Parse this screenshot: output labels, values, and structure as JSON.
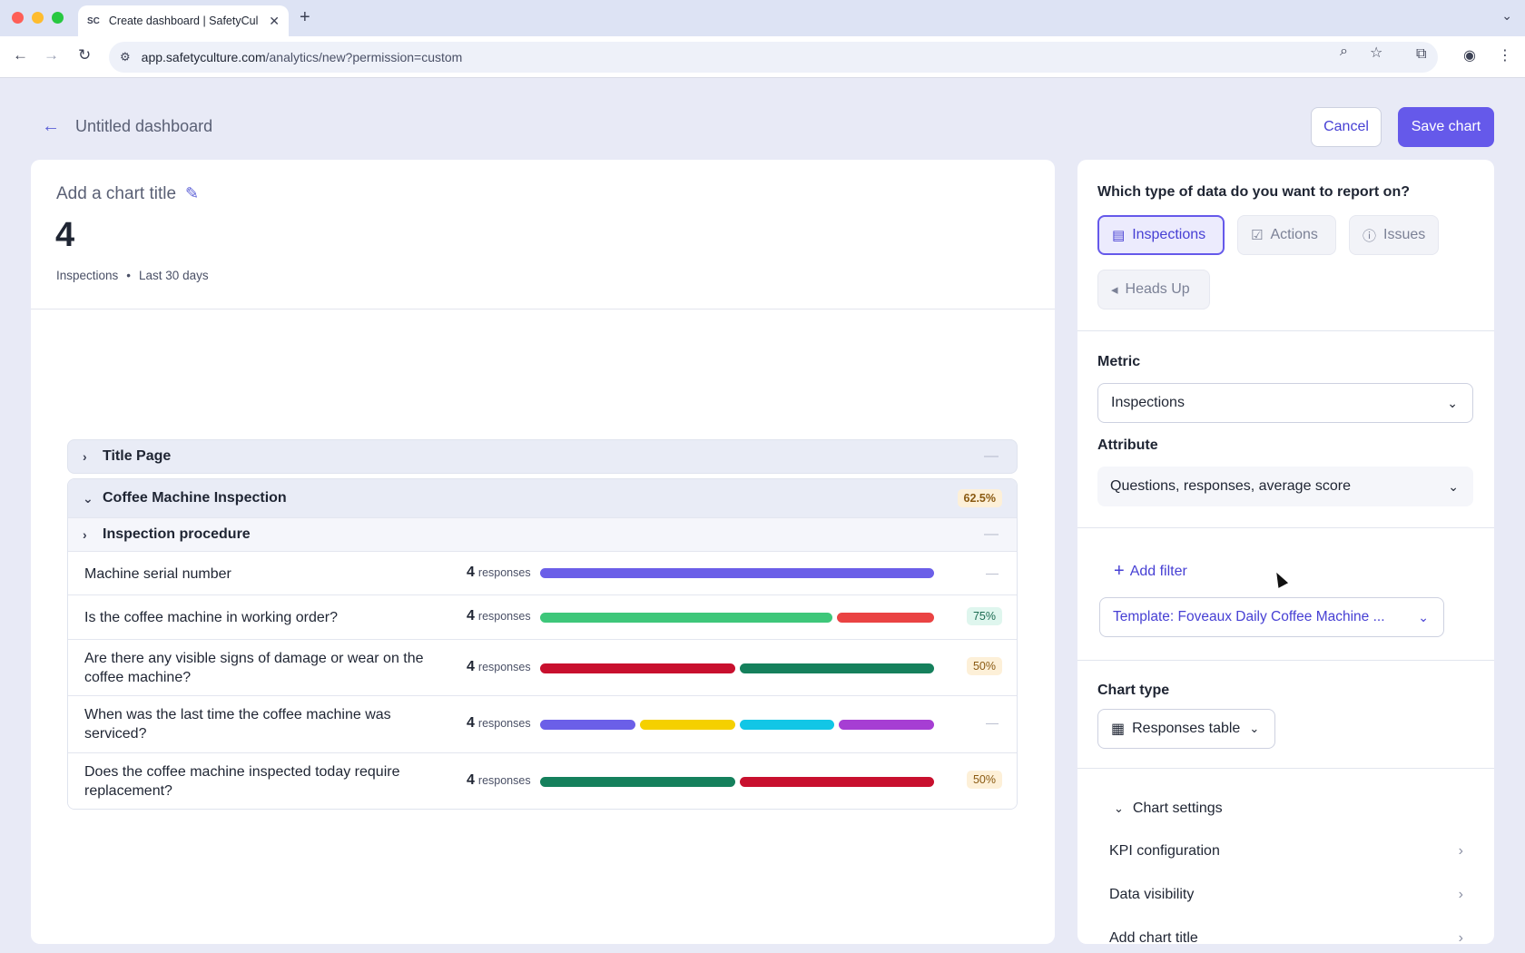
{
  "browser": {
    "tab_title": "Create dashboard | SafetyCul",
    "tab_favicon": "SC",
    "url_host": "app.safetyculture.com",
    "url_path": "/analytics/new?permission=custom"
  },
  "header": {
    "dashboard_title": "Untitled dashboard",
    "cancel_label": "Cancel",
    "save_label": "Save chart"
  },
  "chart": {
    "title_placeholder": "Add a chart title",
    "kpi_value": "4",
    "meta_type": "Inspections",
    "meta_range": "Last 30 days",
    "dash": "—",
    "sections": [
      {
        "label": "Title Page",
        "expanded": false
      },
      {
        "label": "Coffee Machine Inspection",
        "expanded": true,
        "score": "62.5%"
      }
    ],
    "subsection": {
      "label": "Inspection procedure"
    },
    "responses_word": "responses",
    "questions": [
      {
        "text": "Machine serial number",
        "count": "4",
        "segments": [
          {
            "fraction": 1.0,
            "color": "#6b5fe8"
          }
        ],
        "score": null
      },
      {
        "text": "Is the coffee machine in working order?",
        "count": "4",
        "segments": [
          {
            "fraction": 0.75,
            "color": "#3ec77a"
          },
          {
            "fraction": 0.25,
            "color": "#ea4343"
          }
        ],
        "score": "75%",
        "score_tone": "green"
      },
      {
        "text": "Are there any visible signs of damage or wear on the coffee machine?",
        "count": "4",
        "segments": [
          {
            "fraction": 0.5,
            "color": "#c8102e"
          },
          {
            "fraction": 0.5,
            "color": "#15805c"
          }
        ],
        "score": "50%",
        "score_tone": "orange"
      },
      {
        "text": "When was the last time the coffee machine was serviced?",
        "count": "4",
        "segments": [
          {
            "fraction": 0.25,
            "color": "#6b5fe8"
          },
          {
            "fraction": 0.25,
            "color": "#f5d000"
          },
          {
            "fraction": 0.25,
            "color": "#12c6e6"
          },
          {
            "fraction": 0.25,
            "color": "#a63ed3"
          }
        ],
        "score": null
      },
      {
        "text": "Does the coffee machine inspected today require replacement?",
        "count": "4",
        "segments": [
          {
            "fraction": 0.5,
            "color": "#15805c"
          },
          {
            "fraction": 0.5,
            "color": "#c8102e"
          }
        ],
        "score": "50%",
        "score_tone": "orange"
      }
    ]
  },
  "panel": {
    "question": "Which type of data do you want to report on?",
    "data_types": [
      {
        "label": "Inspections",
        "icon": "clipboard-icon",
        "active": true
      },
      {
        "label": "Actions",
        "icon": "checkbox-icon",
        "active": false
      },
      {
        "label": "Issues",
        "icon": "alert-bubble-icon",
        "active": false
      },
      {
        "label": "Heads Up",
        "icon": "megaphone-icon",
        "active": false
      }
    ],
    "metric_label": "Metric",
    "metric_value": "Inspections",
    "attribute_label": "Attribute",
    "attribute_value": "Questions, responses, average score",
    "add_filter_label": "Add filter",
    "filter_value": "Template: Foveaux Daily Coffee Machine ...",
    "chart_type_label": "Chart type",
    "chart_type_value": "Responses table",
    "chart_settings_label": "Chart settings",
    "settings_items": [
      "KPI configuration",
      "Data visibility",
      "Add chart title"
    ]
  },
  "colors": {
    "accent": "#6559ea",
    "accent_text": "#4740d4",
    "background": "#e8eaf6"
  }
}
